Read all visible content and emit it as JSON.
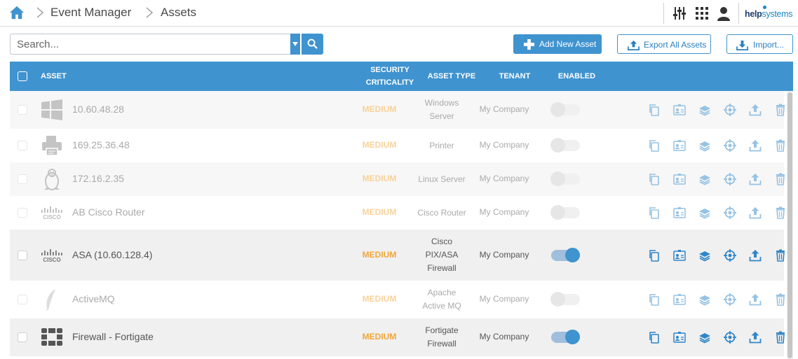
{
  "breadcrumb": {
    "items": [
      "Event Manager",
      "Assets"
    ]
  },
  "brand": {
    "bold": "help",
    "light": "systems"
  },
  "search": {
    "placeholder": "Search..."
  },
  "toolbar": {
    "add_label": "Add New Asset",
    "export_label": "Export All Assets",
    "import_label": "Import..."
  },
  "table": {
    "headers": {
      "asset": "ASSET",
      "criticality_line1": "SECURITY",
      "criticality_line2": "CRITICALITY",
      "type": "ASSET TYPE",
      "tenant": "TENANT",
      "enabled": "ENABLED"
    },
    "rows": [
      {
        "name": "10.60.48.28",
        "icon": "windows-icon",
        "criticality": "MEDIUM",
        "type_lines": [
          "Windows",
          "Server"
        ],
        "tenant": "My Company",
        "enabled": false
      },
      {
        "name": "169.25.36.48",
        "icon": "printer-icon",
        "criticality": "MEDIUM",
        "type_lines": [
          "Printer"
        ],
        "tenant": "My Company",
        "enabled": false
      },
      {
        "name": "172.16.2.35",
        "icon": "linux-icon",
        "criticality": "MEDIUM",
        "type_lines": [
          "Linux Server"
        ],
        "tenant": "My Company",
        "enabled": false
      },
      {
        "name": "AB Cisco Router",
        "icon": "cisco-icon",
        "criticality": "MEDIUM",
        "type_lines": [
          "Cisco Router"
        ],
        "tenant": "My Company",
        "enabled": false
      },
      {
        "name": "ASA (10.60.128.4)",
        "icon": "cisco-icon",
        "criticality": "MEDIUM",
        "type_lines": [
          "Cisco",
          "PIX/ASA",
          "Firewall"
        ],
        "tenant": "My Company",
        "enabled": true
      },
      {
        "name": "ActiveMQ",
        "icon": "feather-icon",
        "criticality": "MEDIUM",
        "type_lines": [
          "Apache",
          "Active MQ"
        ],
        "tenant": "My Company",
        "enabled": false
      },
      {
        "name": "Firewall - Fortigate",
        "icon": "fortinet-icon",
        "criticality": "MEDIUM",
        "type_lines": [
          "Fortigate",
          "Firewall"
        ],
        "tenant": "My Company",
        "enabled": true
      }
    ],
    "row_actions": [
      "copy-icon",
      "id-card-icon",
      "layers-icon",
      "target-icon",
      "upload-icon",
      "trash-icon"
    ]
  },
  "colors": {
    "accent": "#3f93cf",
    "criticality_medium": "#f0a73a"
  }
}
